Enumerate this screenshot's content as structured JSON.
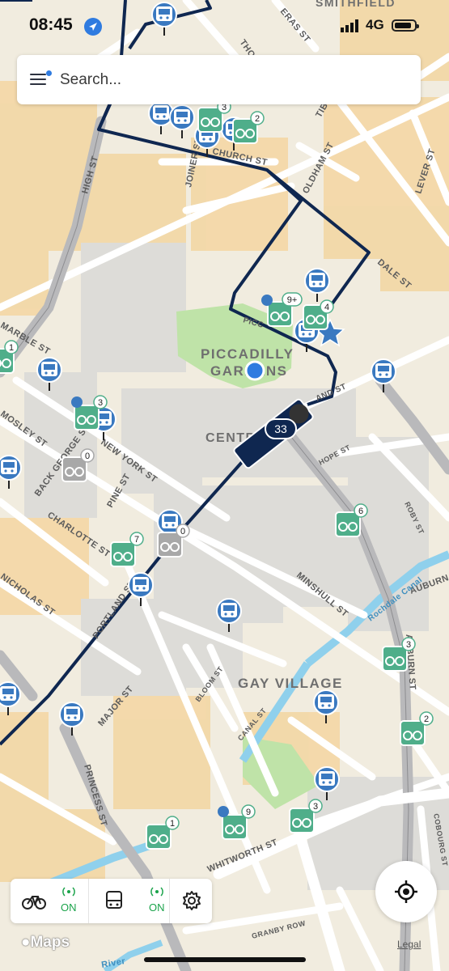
{
  "status_bar": {
    "time": "08:45",
    "network": "4G"
  },
  "search": {
    "placeholder": "Search..."
  },
  "map": {
    "streets": [
      "HIGH ST",
      "JOINER ST",
      "CHURCH ST",
      "OLDHAM ST",
      "LEVER ST",
      "DALE ST",
      "TIB",
      "THO",
      "ERAS ST",
      "MARBLE ST",
      "MOSLEY ST",
      "BACK GEORGE ST",
      "NEW YORK ST",
      "PINE ST",
      "CHARLOTTE ST",
      "NICHOLAS ST",
      "PORTLAND ST",
      "MAJOR ST",
      "PRINCESS ST",
      "BLOOM ST",
      "CANAL ST",
      "MINSHULL ST",
      "HOPE ST",
      "ROBY ST",
      "AUBURN",
      "AUBURN ST",
      "COBOURG ST",
      "WHITWORTH ST",
      "GRANBY ROW",
      "Rochdale Canal",
      "River",
      "PICC",
      "AND ST"
    ],
    "places": [
      "PICCADILLY",
      "GARDENS",
      "CENTRAL",
      "GAY VILLAGE",
      "SMITHFIELD"
    ],
    "route_badge": "33",
    "bike_badges": [
      "3",
      "2",
      "9+",
      "4",
      "1",
      "3",
      "0",
      "7",
      "0",
      "6",
      "3",
      "2",
      "3",
      "9",
      "1"
    ]
  },
  "layers": [
    {
      "icon": "bicycle-icon",
      "status": "ON"
    },
    {
      "icon": "bus-icon",
      "status": "ON"
    }
  ],
  "footer": {
    "maps_label": "Maps",
    "legal": "Legal"
  },
  "colors": {
    "route": "#0f2750",
    "bus_stop": "#3a79c0",
    "bike_dock": "#4fae8a",
    "park": "#bfe3a8",
    "water": "#8fd0ec",
    "on_status": "#1aa34a"
  }
}
